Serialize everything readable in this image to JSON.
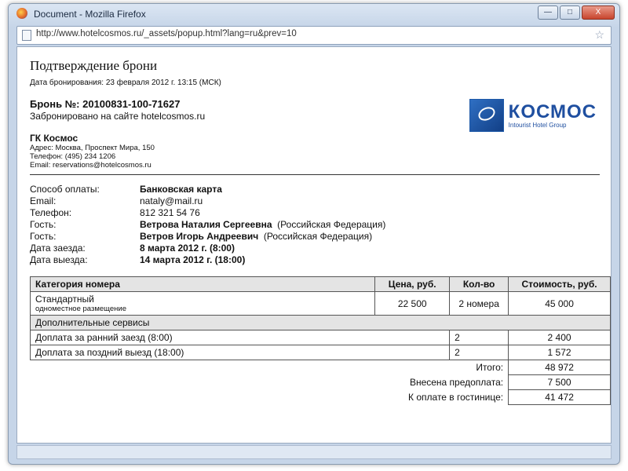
{
  "window": {
    "title": "Document - Mozilla Firefox",
    "controls": {
      "minimize": "—",
      "maximize": "□",
      "close": "X"
    },
    "url": "http://www.hotelcosmos.ru/_assets/popup.html?lang=ru&prev=10"
  },
  "doc": {
    "title": "Подтверждение брони",
    "booking_date": "Дата бронирования: 23 февраля 2012 г. 13:15 (МСК)",
    "booking_number": "Бронь №: 20100831-100-71627",
    "booked_on": "Забронировано на сайте hotelcosmos.ru",
    "company": {
      "name": "ГК Космос",
      "address": "Адрес: Москва, Проспект Мира, 150",
      "phone": "Телефон: (495) 234 1206",
      "email": "Email: reservations@hotelcosmos.ru"
    },
    "logo": {
      "word": "КОСМОС",
      "sub": "Intourist Hotel Group"
    }
  },
  "info": [
    {
      "label": "Способ оплаты:",
      "value": "Банковская карта",
      "bold": true
    },
    {
      "label": "Email:",
      "value": "nataly@mail.ru",
      "bold": false
    },
    {
      "label": "Телефон:",
      "value": "812 321 54 76",
      "bold": false
    },
    {
      "label": "Гость:",
      "value": "Ветрова Наталия Сергеевна",
      "extra": "(Российская Федерация)",
      "bold": true
    },
    {
      "label": "Гость:",
      "value": "Ветров Игорь Андреевич",
      "extra": "(Российская Федерация)",
      "bold": true
    },
    {
      "label": "Дата заезда:",
      "value": "8 марта 2012 г. (8:00)",
      "bold": true
    },
    {
      "label": "Дата выезда:",
      "value": "14 марта 2012 г. (18:00)",
      "bold": true
    }
  ],
  "table": {
    "headers": {
      "category": "Категория номера",
      "price": "Цена, руб.",
      "qty": "Кол-во",
      "cost": "Стоимость, руб."
    },
    "room": {
      "name": "Стандартный",
      "sub": "одноместное размещение",
      "price": "22 500",
      "qty": "2 номера",
      "cost": "45 000"
    },
    "services_header": "Дополнительные сервисы",
    "services": [
      {
        "name": "Доплата за ранний заезд (8:00)",
        "qty": "2",
        "cost": "2 400"
      },
      {
        "name": "Доплата за поздний выезд (18:00)",
        "qty": "2",
        "cost": "1 572"
      }
    ],
    "totals": [
      {
        "label": "Итого:",
        "value": "48 972"
      },
      {
        "label": "Внесена предоплата:",
        "value": "7 500"
      },
      {
        "label": "К оплате в гостинице:",
        "value": "41 472"
      }
    ]
  }
}
